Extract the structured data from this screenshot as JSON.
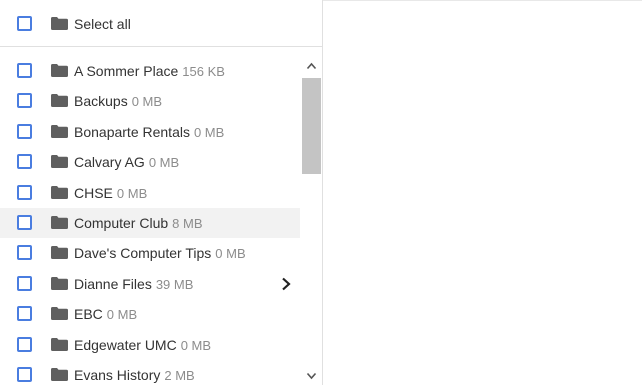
{
  "header": {
    "select_all_label": "Select all"
  },
  "folders": [
    {
      "name": "A Sommer Place",
      "size": "156 KB"
    },
    {
      "name": "Backups",
      "size": "0 MB"
    },
    {
      "name": "Bonaparte Rentals",
      "size": "0 MB"
    },
    {
      "name": "Calvary AG",
      "size": "0 MB"
    },
    {
      "name": "CHSE",
      "size": "0 MB"
    },
    {
      "name": "Computer Club",
      "size": "8 MB"
    },
    {
      "name": "Dave's Computer Tips",
      "size": "0 MB"
    },
    {
      "name": "Dianne Files",
      "size": "39 MB"
    },
    {
      "name": "EBC",
      "size": "0 MB"
    },
    {
      "name": "Edgewater UMC",
      "size": "0 MB"
    },
    {
      "name": "Evans History",
      "size": "2 MB"
    }
  ],
  "highlighted_index": 5,
  "expandable_index": 7,
  "icons": {
    "checkbox": "checkbox-unchecked-icon",
    "folder": "folder-icon",
    "expand": "chevron-right-icon",
    "scroll_up": "chevron-up-icon",
    "scroll_down": "chevron-down-icon"
  },
  "colors": {
    "checkbox_border": "#4a7de0",
    "folder": "#5f5f5f",
    "label": "#333333",
    "size": "#8c8c8c",
    "highlight": "#f2f2f2",
    "scroll_thumb": "#c4c4c4"
  }
}
